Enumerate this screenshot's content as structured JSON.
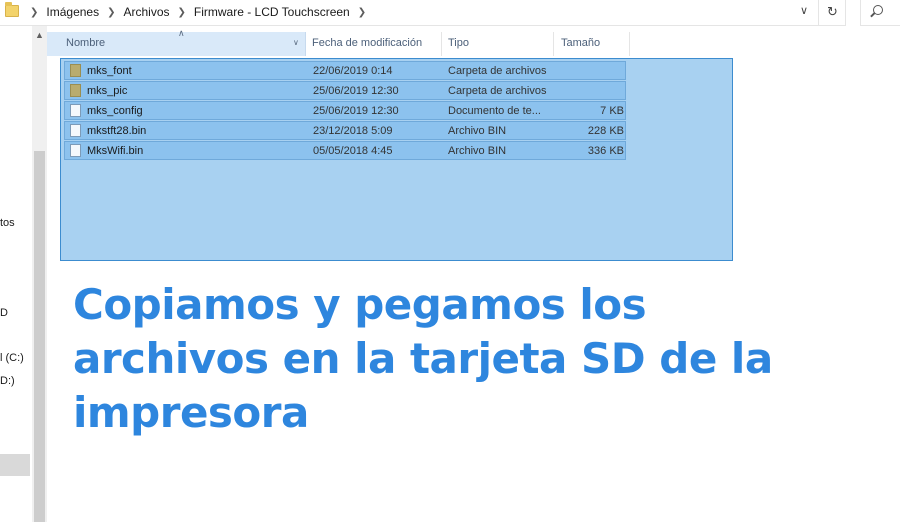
{
  "address_bar": {
    "breadcrumbs": [
      "Imágenes",
      "Archivos",
      "Firmware - LCD Touchscreen"
    ],
    "dropdown_icon": "chevron-down-icon",
    "refresh_icon": "refresh-icon",
    "search_icon": "search-icon"
  },
  "nav_pane": {
    "items": [
      "tos",
      "D",
      "l (C:)",
      "D:)"
    ]
  },
  "columns": {
    "name": "Nombre",
    "date": "Fecha de modificación",
    "type": "Tipo",
    "size": "Tamaño"
  },
  "files": [
    {
      "name": "mks_font",
      "date": "22/06/2019 0:14",
      "type": "Carpeta de archivos",
      "size": "",
      "icon": "folder-icon"
    },
    {
      "name": "mks_pic",
      "date": "25/06/2019 12:30",
      "type": "Carpeta de archivos",
      "size": "",
      "icon": "folder-icon"
    },
    {
      "name": "mks_config",
      "date": "25/06/2019 12:30",
      "type": "Documento de te...",
      "size": "7 KB",
      "icon": "file-icon"
    },
    {
      "name": "mkstft28.bin",
      "date": "23/12/2018 5:09",
      "type": "Archivo BIN",
      "size": "228 KB",
      "icon": "file-icon"
    },
    {
      "name": "MksWifi.bin",
      "date": "05/05/2018 4:45",
      "type": "Archivo BIN",
      "size": "336 KB",
      "icon": "file-icon"
    }
  ],
  "caption": {
    "line1": "Copiamos y pegamos los",
    "line2": "archivos en la tarjeta SD de la",
    "line3": "impresora"
  },
  "colors": {
    "caption": "#2e86de",
    "selection": "#99c9ef",
    "row_selected": "#8cc2ee"
  }
}
